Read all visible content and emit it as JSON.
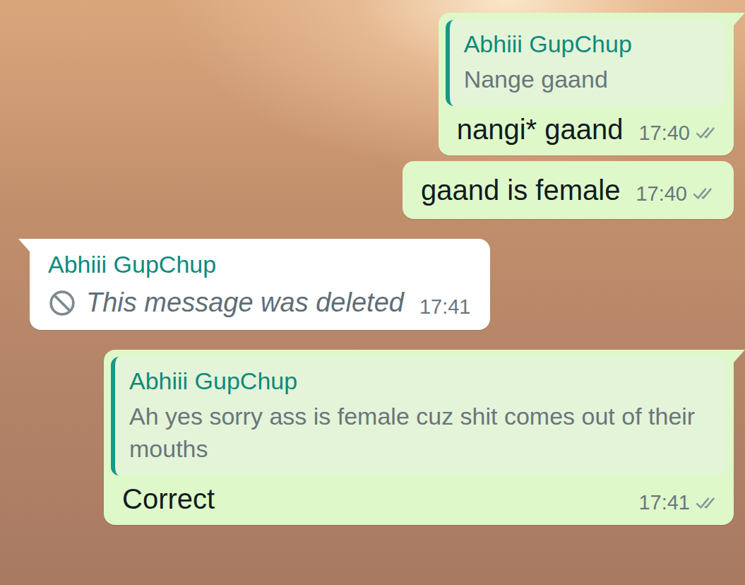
{
  "messages": [
    {
      "direction": "outgoing",
      "tail": true,
      "quote": {
        "author": "Abhiii GupChup",
        "text": "Nange gaand"
      },
      "text": "nangi* gaand",
      "time": "17:40",
      "read": false
    },
    {
      "direction": "outgoing",
      "tail": false,
      "text": "gaand is female",
      "time": "17:40",
      "read": false
    },
    {
      "direction": "incoming",
      "tail": true,
      "author": "Abhiii GupChup",
      "deleted": true,
      "text": "This message was deleted",
      "time": "17:41"
    },
    {
      "direction": "outgoing",
      "tail": true,
      "quote": {
        "author": "Abhiii GupChup",
        "text": "Ah yes sorry ass is female cuz shit comes out of their mouths"
      },
      "text": "Correct",
      "time": "17:41",
      "read": false
    }
  ]
}
